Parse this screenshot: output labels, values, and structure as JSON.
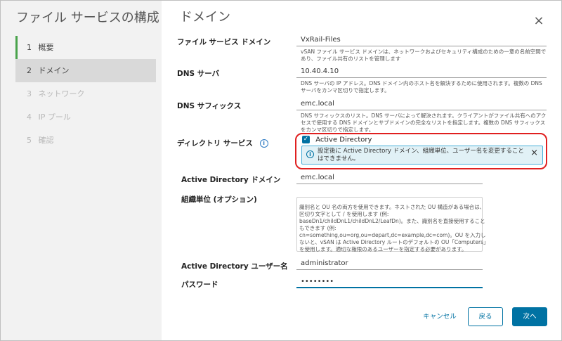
{
  "sidebar": {
    "title": "ファイル サービスの構成",
    "steps": [
      {
        "num": "1",
        "label": "概要"
      },
      {
        "num": "2",
        "label": "ドメイン"
      },
      {
        "num": "3",
        "label": "ネットワーク"
      },
      {
        "num": "4",
        "label": "IP プール"
      },
      {
        "num": "5",
        "label": "確認"
      }
    ]
  },
  "main": {
    "title": "ドメイン",
    "close_icon": "×",
    "fields": {
      "file_services_domain": {
        "label": "ファイル サービス ドメイン",
        "value": "VxRail-Files",
        "help": "vSAN ファイル サービス ドメインは、ネットワークおよびセキュリティ構成のための一意の名前空間であり、ファイル共有のリストを管理します"
      },
      "dns_servers": {
        "label": "DNS サーバ",
        "value": "10.40.4.10",
        "help": "DNS サーバの IP アドレス。DNS ドメイン内のホスト名を解決するために使用されます。複数の DNS サーバをカンマ区切りで指定します。"
      },
      "dns_suffixes": {
        "label": "DNS サフィックス",
        "value": "emc.local",
        "help": "DNS サフィックスのリスト。DNS サーバによって解決されます。クライアントがファイル共有へのアクセスで使用する DNS ドメインとサブドメインの完全なリストを指定します。複数の DNS サフィックスをカンマ区切りで指定します。"
      },
      "directory_service": {
        "label": "ディレクトリ サービス",
        "info_icon": "i",
        "checkbox_label": "Active Directory",
        "checkbox_mark": "✓",
        "alert_icon": "i",
        "alert_text": "設定後に Active Directory ドメイン、組織単位、ユーザー名を変更することはできません。",
        "alert_close": "×"
      },
      "ad_domain": {
        "label": "Active Directory ドメイン",
        "value": "emc.local"
      },
      "ou": {
        "label": "組織単位 (オプション)",
        "help": "識別名と OU 名の両方を使用できます。ネストされた OU 構造がある場合は、区切り文字として / を使用します (例: baseDn1/childDnL1/childDnL2/LeafDn)。また、識別名を直接使用することもできます (例: cn=something,ou=org,ou=depart,dc=example,dc=com)。OU を入力しないと、vSAN は Active Directory ルートのデフォルトの OU「Computers」を使用します。適切な権限のあるユーザーを指定する必要があります。"
      },
      "ad_username": {
        "label": "Active Directory ユーザー名",
        "value": "administrator"
      },
      "password": {
        "label": "パスワード",
        "value": "••••••••"
      }
    }
  },
  "footer": {
    "cancel_label": "キャンセル",
    "back_label": "戻る",
    "next_label": "次へ"
  },
  "colors": {
    "primary": "#0072a3",
    "active_step": "#49a34b",
    "highlight": "#e02020",
    "alert_bg": "#e1f1f6"
  }
}
